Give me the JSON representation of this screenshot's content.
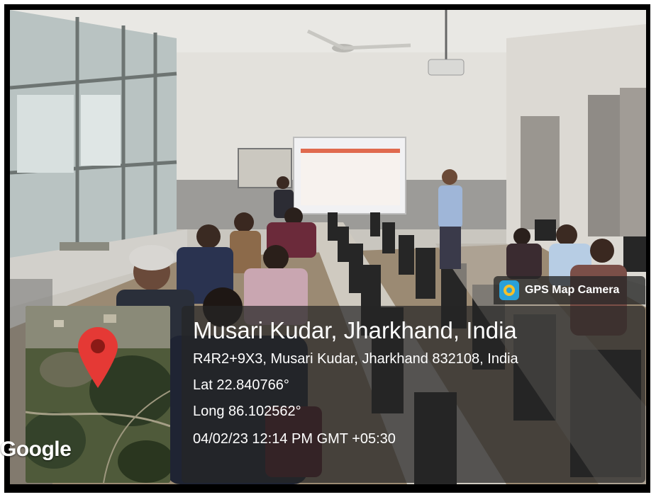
{
  "gps_badge": {
    "label": "GPS Map Camera",
    "icon": "gps-map-camera-icon"
  },
  "map": {
    "provider": "Google",
    "pin_icon": "location-pin-icon"
  },
  "info": {
    "place": "Musari Kudar, Jharkhand, India",
    "address": "R4R2+9X3, Musari Kudar, Jharkhand 832108, India",
    "latitude": "Lat 22.840766°",
    "longitude": "Long 86.102562°",
    "datetime": "04/02/23 12:14 PM GMT +05:30"
  },
  "colors": {
    "overlay": "#262626",
    "pin": "#e53935",
    "icon_bg": "#2aa0d8",
    "icon_fg": "#f5c02a"
  }
}
